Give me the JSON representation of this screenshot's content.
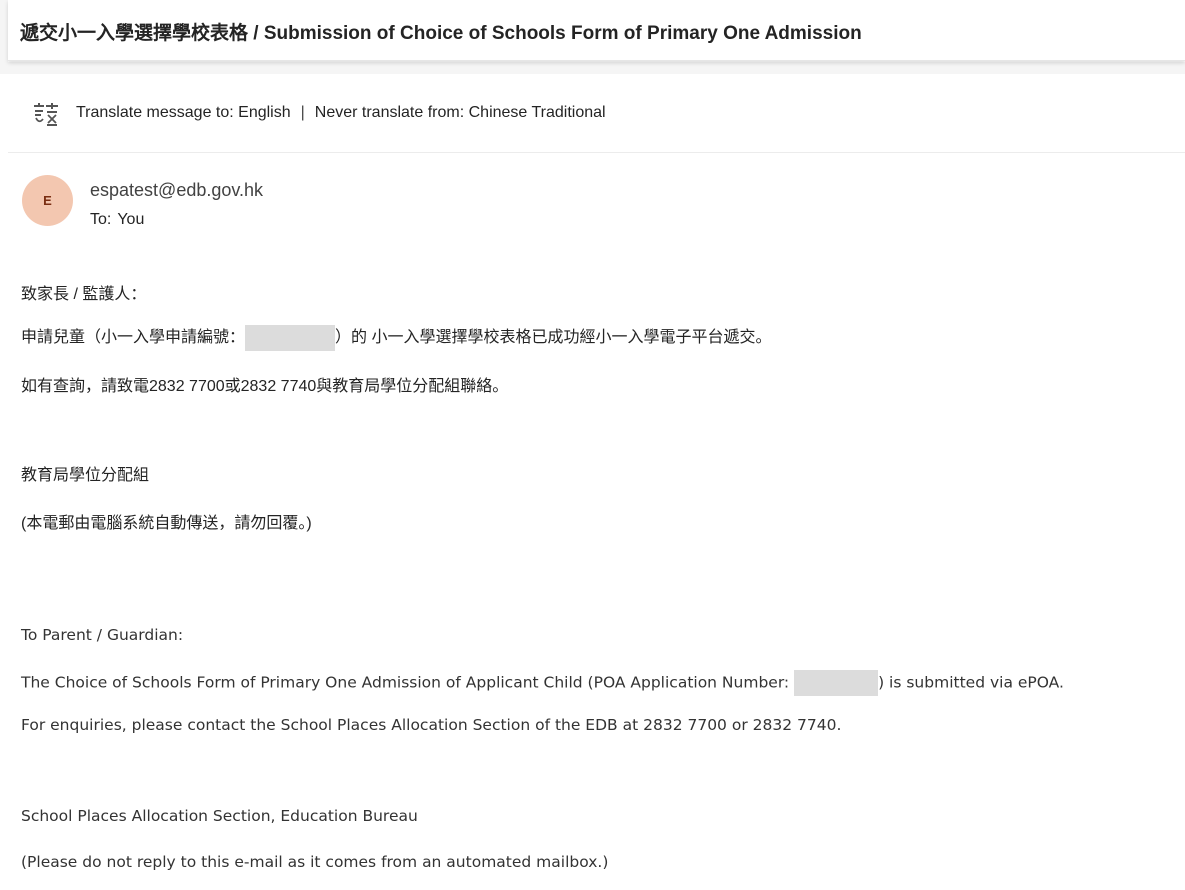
{
  "subject": "遞交小一入學選擇學校表格 / Submission of Choice of Schools Form of Primary One Admission",
  "translate": {
    "icon": "translate-icon",
    "translate_to": "Translate message to: English",
    "separator": "|",
    "never_translate": "Never translate from: Chinese Traditional"
  },
  "sender": {
    "avatar_initial": "E",
    "email": "espatest@edb.gov.hk",
    "to_label": "To:",
    "to_value": "You"
  },
  "body": {
    "zh_greeting": "致家長 / 監護人：",
    "zh_line1_a": "申請兒童（小一入學申請編號：",
    "zh_line1_b": "）的 小一入學選擇學校表格已成功經小一入學電子平台遞交。",
    "zh_line2": "如有查詢，請致電2832 7700或2832 7740與教育局學位分配組聯絡。",
    "zh_signoff": "教育局學位分配組",
    "zh_note": "(本電郵由電腦系統自動傳送，請勿回覆。)",
    "en_greeting": "To Parent / Guardian:",
    "en_line1_a": "The Choice of Schools Form of Primary One Admission of Applicant Child (POA Application Number: ",
    "en_line1_b": ") is submitted via ePOA.",
    "en_line2": "For enquiries, please contact the School Places Allocation Section of the EDB at 2832 7700 or 2832 7740.",
    "en_signoff": "School Places Allocation Section, Education Bureau",
    "en_note": "(Please do not reply to this e-mail as it comes from an automated mailbox.)"
  },
  "colors": {
    "avatar_bg": "#f3c7b0",
    "avatar_text": "#7a2e12",
    "redaction": "#dcdcdc"
  }
}
